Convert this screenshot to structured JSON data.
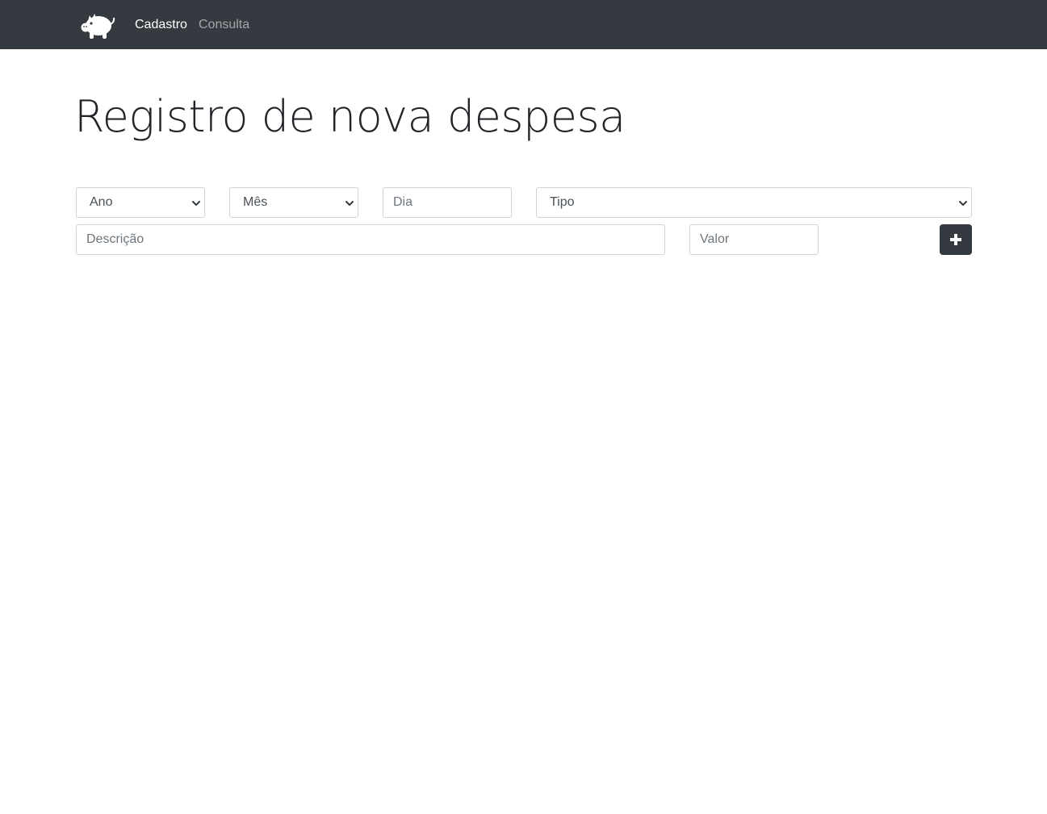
{
  "nav": {
    "logo_icon": "piggy-bank-icon",
    "items": [
      {
        "label": "Cadastro",
        "active": true
      },
      {
        "label": "Consulta",
        "active": false
      }
    ],
    "background": "#343a40"
  },
  "page": {
    "title": "Registro de nova despesa"
  },
  "form": {
    "ano": {
      "value": "Ano"
    },
    "mes": {
      "value": "Mês"
    },
    "dia": {
      "placeholder": "Dia"
    },
    "tipo": {
      "value": "Tipo"
    },
    "descricao": {
      "placeholder": "Descrição"
    },
    "valor": {
      "placeholder": "Valor"
    },
    "add_button_icon": "plus-icon"
  }
}
